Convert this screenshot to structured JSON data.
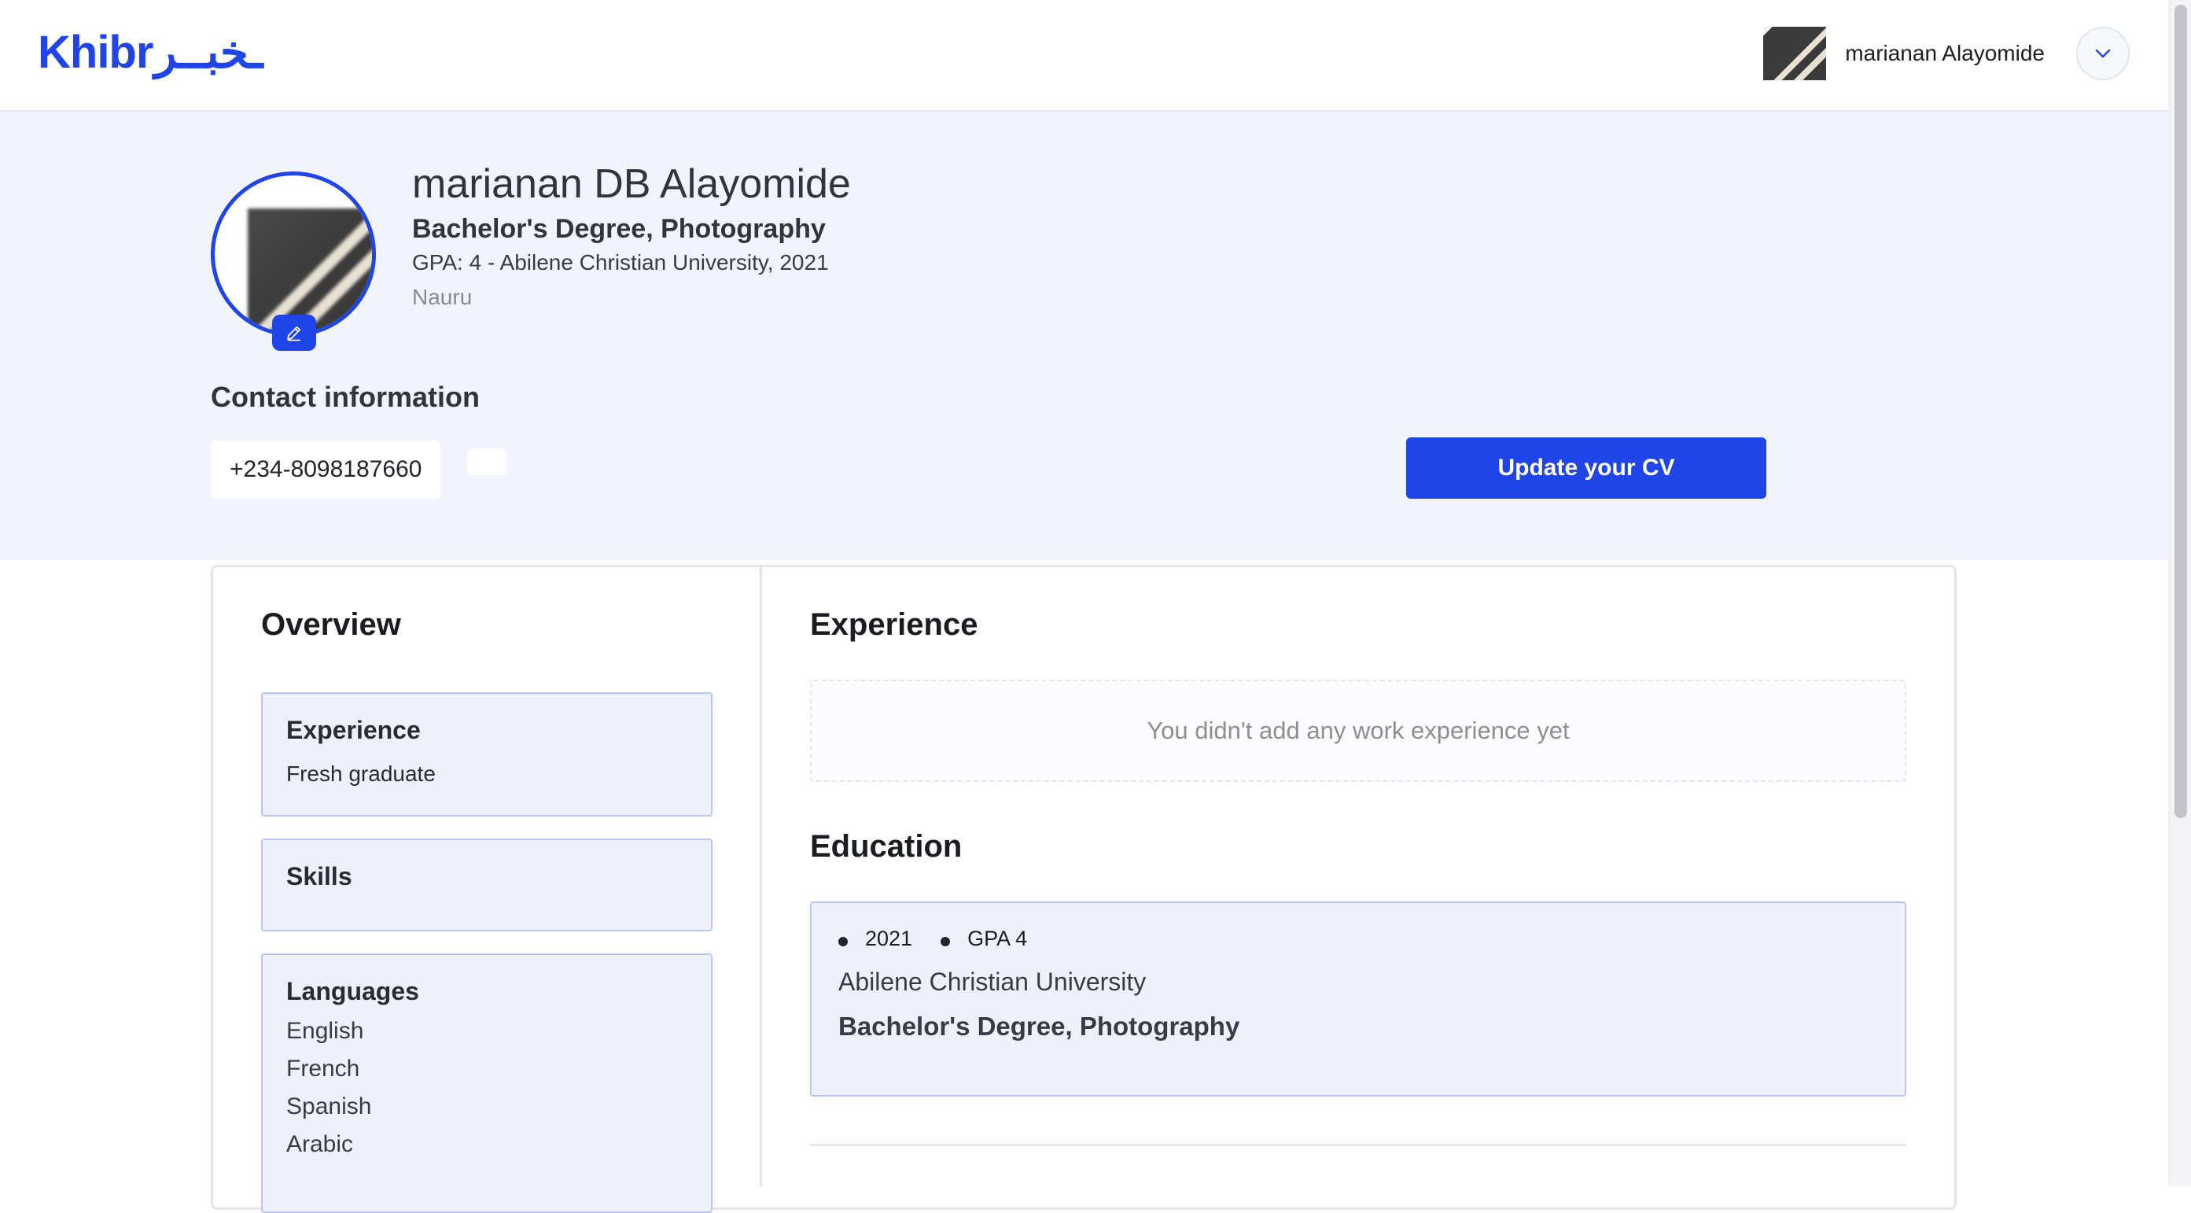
{
  "header": {
    "logo_latin": "Khibr",
    "logo_arabic": "ـخبــر",
    "user_name": "marianan Alayomide"
  },
  "profile": {
    "name": "marianan DB Alayomide",
    "degree": "Bachelor's Degree, Photography",
    "gpa_line": "GPA: 4 - Abilene Christian University, 2021",
    "country": "Nauru",
    "contact_title": "Contact information",
    "phone": "+234-8098187660",
    "update_cv_label": "Update your CV"
  },
  "overview": {
    "title": "Overview",
    "experience_title": "Experience",
    "experience_value": "Fresh graduate",
    "skills_title": "Skills",
    "languages_title": "Languages",
    "languages": [
      "English",
      "French",
      "Spanish",
      "Arabic"
    ]
  },
  "experience": {
    "title": "Experience",
    "empty_text": "You didn't add any work experience yet"
  },
  "education": {
    "title": "Education",
    "year": "2021",
    "gpa": "GPA 4",
    "university": "Abilene Christian University",
    "degree": "Bachelor's Degree, Photography"
  },
  "colors": {
    "accent": "#1f44e8",
    "band_bg": "#f1f4fc",
    "box_bg": "#eef1fc"
  }
}
